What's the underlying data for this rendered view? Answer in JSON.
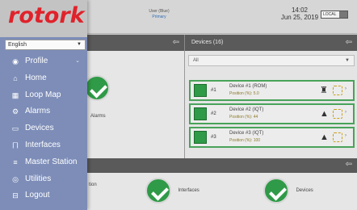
{
  "header": {
    "logo_text": "rotork",
    "user_name": "User (Blue)",
    "user_role": "Primary",
    "time": "14:02",
    "date": "Jun 25, 2019",
    "toggle_label": "LOCAL"
  },
  "menu": {
    "language": "English",
    "items": [
      {
        "label": "Profile",
        "icon": "user-circle-icon",
        "glyph": "◉",
        "has_chevron": true
      },
      {
        "label": "Home",
        "icon": "home-icon",
        "glyph": "⌂"
      },
      {
        "label": "Loop Map",
        "icon": "map-icon",
        "glyph": "▦"
      },
      {
        "label": "Alarms",
        "icon": "gear-alarm-icon",
        "glyph": "⚙"
      },
      {
        "label": "Devices",
        "icon": "devices-icon",
        "glyph": "▭"
      },
      {
        "label": "Interfaces",
        "icon": "interfaces-icon",
        "glyph": "⨅"
      },
      {
        "label": "Master Station",
        "icon": "server-icon",
        "glyph": "≡"
      },
      {
        "label": "Utilities",
        "icon": "utilities-icon",
        "glyph": "◎"
      },
      {
        "label": "Logout",
        "icon": "logout-icon",
        "glyph": "⊟"
      }
    ]
  },
  "left_panel": {
    "alarms_label": "Alarms"
  },
  "devices_panel": {
    "title": "Devices (16)",
    "filter_value": "All",
    "rows": [
      {
        "num": "#1",
        "name": "Device #1 (ROM)",
        "status": "Position (%): 5.0"
      },
      {
        "num": "#2",
        "name": "Device #2 (IQT)",
        "status": "Position (%): 44"
      },
      {
        "num": "#3",
        "name": "Device #3 (IQT)",
        "status": "Position (%): 100"
      }
    ]
  },
  "bottom_panel": {
    "stat_left": "tion",
    "stat_mid": "Interfaces",
    "stat_right": "Devices"
  },
  "colors": {
    "brand_red": "#e0222b",
    "menu_bg": "#7d8db8",
    "ok_green": "#2f9a47",
    "header_gray": "#5a5a5a"
  }
}
